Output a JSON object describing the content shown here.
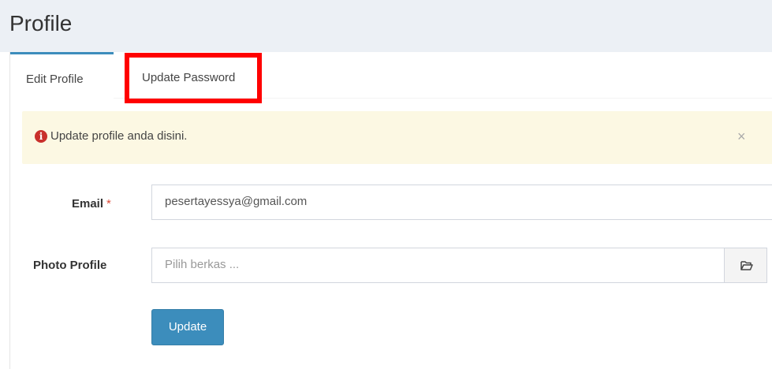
{
  "page": {
    "title": "Profile"
  },
  "tabs": [
    {
      "label": "Edit Profile",
      "active": true
    },
    {
      "label": "Update Password",
      "active": false
    }
  ],
  "alert": {
    "icon": "info-circle-icon",
    "message": "Update profile anda disini.",
    "close": "×"
  },
  "form": {
    "email": {
      "label": "Email",
      "required_mark": "*",
      "value": "pesertayessya@gmail.com"
    },
    "photo": {
      "label": "Photo Profile",
      "placeholder": "Pilih berkas ...",
      "browse_icon": "folder-open-icon"
    },
    "submit_label": "Update"
  },
  "colors": {
    "accent": "#3c8dbc",
    "alert_bg": "#fcf8e3",
    "highlight": "#ff0000",
    "required": "#dd4b39"
  }
}
